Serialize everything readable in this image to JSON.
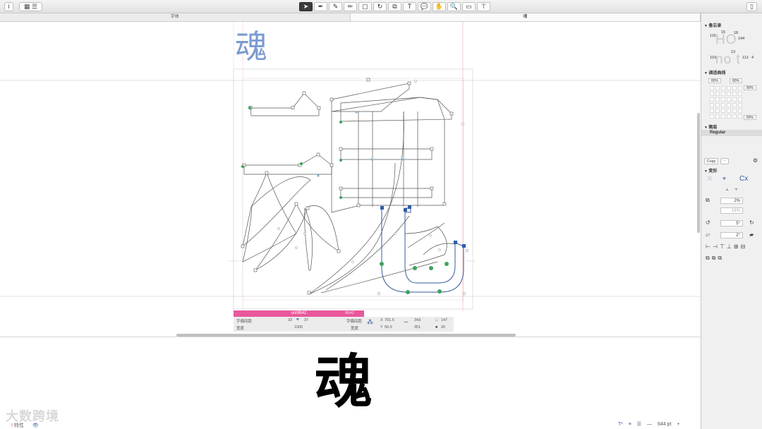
{
  "toolbar": {
    "info_icon": "info-icon",
    "view_buttons": [
      "grid-view-icon",
      "list-view-icon"
    ],
    "tools": [
      "select-arrow-icon",
      "pen-icon",
      "draw-icon",
      "pencil-icon",
      "primitives-icon",
      "rotate-icon",
      "scale-icon",
      "text-icon",
      "annotation-icon",
      "hand-icon",
      "zoom-icon",
      "measure-icon",
      "component-icon"
    ],
    "sidebar_toggle": "sidebar-toggle-icon"
  },
  "tabs": [
    {
      "label": "字体",
      "active": false
    },
    {
      "label": "魂",
      "active": true
    }
  ],
  "canvas": {
    "glyph_preview": "魂",
    "info": {
      "name": "uni9B42",
      "code": "9B42",
      "lsb_label": "字偶间距",
      "lsb_left": "33",
      "lsb_right": "37",
      "width_label": "宽度",
      "width": "1000",
      "rsb_label": "字偶间距",
      "rsb_label2": "宽度",
      "x_label": "X",
      "x": "791.5",
      "y_label": "Y",
      "y": "50.5",
      "w": "343",
      "h": "351",
      "n1": "147",
      "n2": "26"
    }
  },
  "preview": {
    "glyph": "魂",
    "watermark": "大数跨境",
    "bottom_left": "特性",
    "size": "644 pt"
  },
  "sidebar": {
    "kerning": {
      "title": "备忘录",
      "nums_top": [
        "116",
        "15",
        "18",
        "144"
      ],
      "nums_bottom": [
        "103",
        "13",
        "112",
        "4"
      ],
      "letters_top": "HO",
      "letters_bottom": "no t"
    },
    "curve": {
      "title": "调适曲线",
      "pct1": "80%",
      "pct2": "80%",
      "pct3": "80%",
      "pct4": "80%"
    },
    "layers": {
      "title": "图层",
      "regular": "Regular"
    },
    "transform": {
      "copy": "Copy",
      "title": "变形",
      "scale": "2%",
      "scale2": "16%",
      "rotate": "5°",
      "slant": "2°"
    }
  }
}
